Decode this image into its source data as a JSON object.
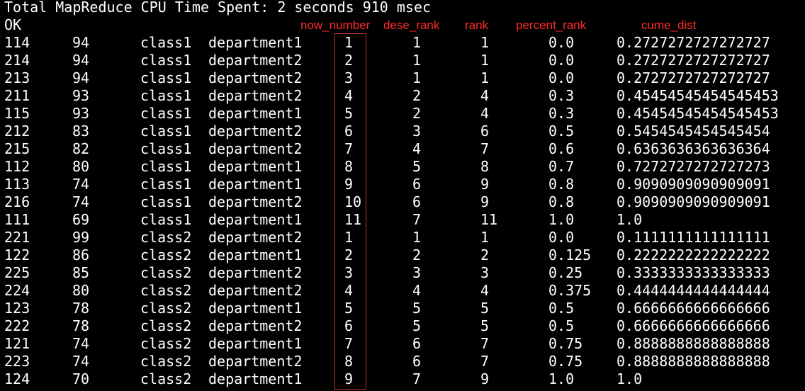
{
  "terminal": {
    "header_line": "Total MapReduce CPU Time Spent: 2 seconds 910 msec",
    "status_line": "OK"
  },
  "annotations": {
    "row_number": "now_number",
    "dense_rank": "dese_rank",
    "rank": "rank",
    "percent_rank": "percent_rank",
    "cume_dist": "cume_dist",
    "color": "#ff2a2a",
    "box_color": "#c0392b"
  },
  "rows": [
    {
      "id": "114",
      "score": "94",
      "class": "class1",
      "dept": "department1",
      "row_number": "1",
      "dense_rank": "1",
      "rank": "1",
      "percent_rank": "0.0",
      "cume_dist": "0.2727272727272727"
    },
    {
      "id": "214",
      "score": "94",
      "class": "class1",
      "dept": "department2",
      "row_number": "2",
      "dense_rank": "1",
      "rank": "1",
      "percent_rank": "0.0",
      "cume_dist": "0.2727272727272727"
    },
    {
      "id": "213",
      "score": "94",
      "class": "class1",
      "dept": "department2",
      "row_number": "3",
      "dense_rank": "1",
      "rank": "1",
      "percent_rank": "0.0",
      "cume_dist": "0.2727272727272727"
    },
    {
      "id": "211",
      "score": "93",
      "class": "class1",
      "dept": "department2",
      "row_number": "4",
      "dense_rank": "2",
      "rank": "4",
      "percent_rank": "0.3",
      "cume_dist": "0.45454545454545453"
    },
    {
      "id": "115",
      "score": "93",
      "class": "class1",
      "dept": "department1",
      "row_number": "5",
      "dense_rank": "2",
      "rank": "4",
      "percent_rank": "0.3",
      "cume_dist": "0.45454545454545453"
    },
    {
      "id": "212",
      "score": "83",
      "class": "class1",
      "dept": "department2",
      "row_number": "6",
      "dense_rank": "3",
      "rank": "6",
      "percent_rank": "0.5",
      "cume_dist": "0.5454545454545454"
    },
    {
      "id": "215",
      "score": "82",
      "class": "class1",
      "dept": "department2",
      "row_number": "7",
      "dense_rank": "4",
      "rank": "7",
      "percent_rank": "0.6",
      "cume_dist": "0.6363636363636364"
    },
    {
      "id": "112",
      "score": "80",
      "class": "class1",
      "dept": "department1",
      "row_number": "8",
      "dense_rank": "5",
      "rank": "8",
      "percent_rank": "0.7",
      "cume_dist": "0.7272727272727273"
    },
    {
      "id": "113",
      "score": "74",
      "class": "class1",
      "dept": "department1",
      "row_number": "9",
      "dense_rank": "6",
      "rank": "9",
      "percent_rank": "0.8",
      "cume_dist": "0.9090909090909091"
    },
    {
      "id": "216",
      "score": "74",
      "class": "class1",
      "dept": "department2",
      "row_number": "10",
      "dense_rank": "6",
      "rank": "9",
      "percent_rank": "0.8",
      "cume_dist": "0.9090909090909091"
    },
    {
      "id": "111",
      "score": "69",
      "class": "class1",
      "dept": "department1",
      "row_number": "11",
      "dense_rank": "7",
      "rank": "11",
      "percent_rank": "1.0",
      "cume_dist": "1.0"
    },
    {
      "id": "221",
      "score": "99",
      "class": "class2",
      "dept": "department2",
      "row_number": "1",
      "dense_rank": "1",
      "rank": "1",
      "percent_rank": "0.0",
      "cume_dist": "0.1111111111111111"
    },
    {
      "id": "122",
      "score": "86",
      "class": "class2",
      "dept": "department1",
      "row_number": "2",
      "dense_rank": "2",
      "rank": "2",
      "percent_rank": "0.125",
      "cume_dist": "0.2222222222222222"
    },
    {
      "id": "225",
      "score": "85",
      "class": "class2",
      "dept": "department2",
      "row_number": "3",
      "dense_rank": "3",
      "rank": "3",
      "percent_rank": "0.25",
      "cume_dist": "0.3333333333333333"
    },
    {
      "id": "224",
      "score": "80",
      "class": "class2",
      "dept": "department2",
      "row_number": "4",
      "dense_rank": "4",
      "rank": "4",
      "percent_rank": "0.375",
      "cume_dist": "0.4444444444444444"
    },
    {
      "id": "123",
      "score": "78",
      "class": "class2",
      "dept": "department1",
      "row_number": "5",
      "dense_rank": "5",
      "rank": "5",
      "percent_rank": "0.5",
      "cume_dist": "0.6666666666666666"
    },
    {
      "id": "222",
      "score": "78",
      "class": "class2",
      "dept": "department2",
      "row_number": "6",
      "dense_rank": "5",
      "rank": "5",
      "percent_rank": "0.5",
      "cume_dist": "0.6666666666666666"
    },
    {
      "id": "121",
      "score": "74",
      "class": "class2",
      "dept": "department1",
      "row_number": "7",
      "dense_rank": "6",
      "rank": "7",
      "percent_rank": "0.75",
      "cume_dist": "0.8888888888888888"
    },
    {
      "id": "223",
      "score": "74",
      "class": "class2",
      "dept": "department2",
      "row_number": "8",
      "dense_rank": "6",
      "rank": "7",
      "percent_rank": "0.75",
      "cume_dist": "0.8888888888888888"
    },
    {
      "id": "124",
      "score": "70",
      "class": "class2",
      "dept": "department1",
      "row_number": "9",
      "dense_rank": "7",
      "rank": "9",
      "percent_rank": "1.0",
      "cume_dist": "1.0"
    }
  ]
}
